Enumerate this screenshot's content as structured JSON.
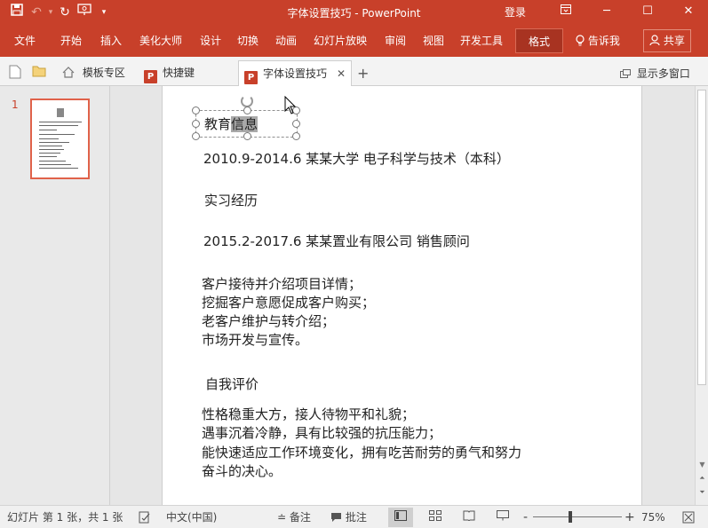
{
  "app": {
    "window_title": "字体设置技巧  -  PowerPoint",
    "login": "登录"
  },
  "ribbon": {
    "tabs": [
      "文件",
      "开始",
      "插入",
      "美化大师",
      "设计",
      "切换",
      "动画",
      "幻灯片放映",
      "审阅",
      "视图",
      "开发工具",
      "格式"
    ],
    "active_tab": "格式",
    "tell_me": "告诉我",
    "share": "共享"
  },
  "doc_tabs": {
    "tabs": [
      "模板专区",
      "快捷键",
      "字体设置技巧"
    ],
    "active": "字体设置技巧",
    "multi_window": "显示多窗口"
  },
  "slide_panel": {
    "slide_number": "1"
  },
  "slide": {
    "lines": {
      "edu_title_a": "教育",
      "edu_title_b": "信息",
      "edu_detail": "2010.9-2014.6   某某大学 电子科学与技术（本科）",
      "intern_title": "实习经历",
      "intern_detail": "2015.2-2017.6   某某置业有限公司 销售顾问",
      "duty_1": "客户接待并介绍项目详情；",
      "duty_2": "挖掘客户意愿促成客户购买；",
      "duty_3": "老客户维护与转介绍；",
      "duty_4": "市场开发与宣传。",
      "self_title": "自我评价",
      "self_1": "性格稳重大方，接人待物平和礼貌；",
      "self_2": "遇事沉着冷静，具有比较强的抗压能力；",
      "self_3": "能快速适应工作环境变化，拥有吃苦耐劳的勇气和努力",
      "self_4": "奋斗的决心。"
    }
  },
  "status_bar": {
    "slide_info": "幻灯片 第 1 张，共 1 张",
    "language": "中文(中国)",
    "notes": "备注",
    "comments": "批注",
    "zoom_minus": "-",
    "zoom_plus": "+",
    "zoom": "75%",
    "zoom_fraction": 0.42
  },
  "colors": {
    "accent": "#c8402a",
    "active_tab_bg": "#a83321",
    "selection": "#a9a9a9"
  }
}
